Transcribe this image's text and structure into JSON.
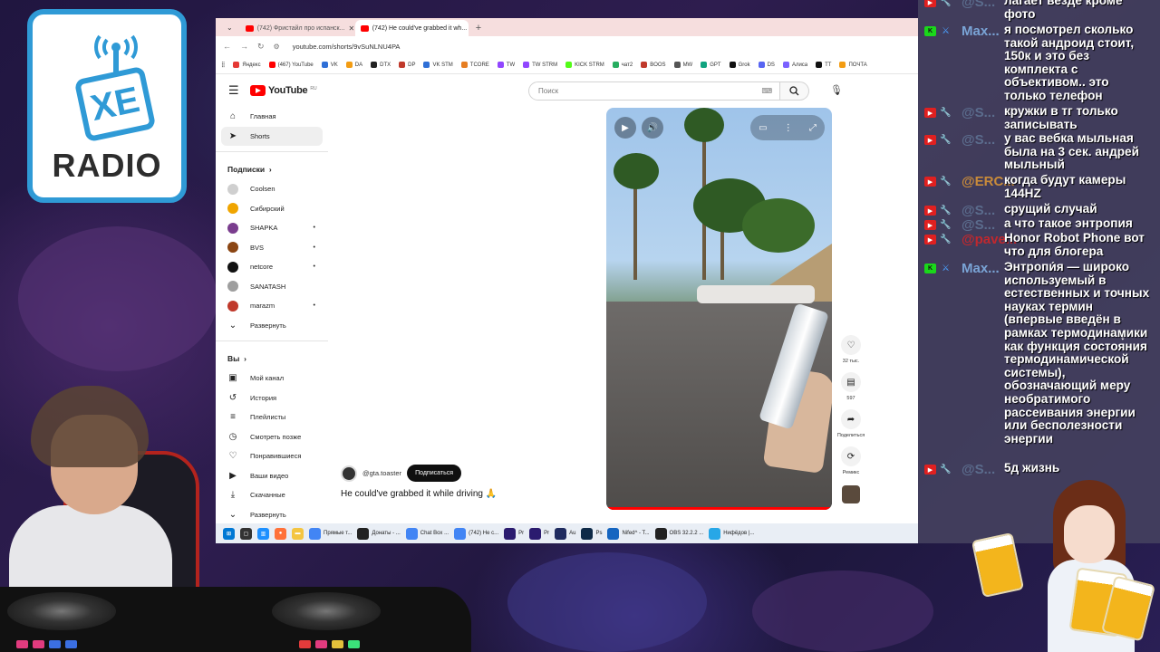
{
  "overlay": {
    "logo_text": "RADIO",
    "logo_mark": "XE"
  },
  "browser": {
    "tabs": [
      {
        "label": "(742) Фристайл про испанск...",
        "active": false
      },
      {
        "label": "(742) He could've grabbed it wh...",
        "active": true
      }
    ],
    "url": "youtube.com/shorts/9vSuNLNU4PA",
    "bookmarks": [
      {
        "label": "Яндекс",
        "color": "#e53935"
      },
      {
        "label": "(467) YouTube",
        "color": "#ff0000"
      },
      {
        "label": "VK",
        "color": "#2f6fd6"
      },
      {
        "label": "DA",
        "color": "#f39c12"
      },
      {
        "label": "DTX",
        "color": "#222222"
      },
      {
        "label": "DP",
        "color": "#c0392b"
      },
      {
        "label": "VK STM",
        "color": "#2f6fd6"
      },
      {
        "label": "TCORE",
        "color": "#e67e22"
      },
      {
        "label": "TW",
        "color": "#9146ff"
      },
      {
        "label": "TW STRM",
        "color": "#9146ff"
      },
      {
        "label": "KICK STRM",
        "color": "#53fc18"
      },
      {
        "label": "чат2",
        "color": "#27ae60"
      },
      {
        "label": "BOOS",
        "color": "#c0392b"
      },
      {
        "label": "MW",
        "color": "#555555"
      },
      {
        "label": "GPT",
        "color": "#10a37f"
      },
      {
        "label": "Grok",
        "color": "#111111"
      },
      {
        "label": "DS",
        "color": "#5865f2"
      },
      {
        "label": "Алиса",
        "color": "#7b61ff"
      },
      {
        "label": "TT",
        "color": "#111111"
      },
      {
        "label": "ПОЧТА",
        "color": "#f39c12"
      }
    ]
  },
  "youtube": {
    "logo_text": "YouTube",
    "logo_region": "RU",
    "search_placeholder": "Поиск",
    "nav": [
      {
        "label": "Главная",
        "icon": "home-icon",
        "glyph": "⌂",
        "active": false
      },
      {
        "label": "Shorts",
        "icon": "shorts-icon",
        "glyph": "➤",
        "active": true
      }
    ],
    "subscriptions_header": "Подписки",
    "subscriptions": [
      {
        "label": "Coolsen",
        "color": "#cfcfcf",
        "live": false
      },
      {
        "label": "Сибирский",
        "color": "#f0a500",
        "live": false
      },
      {
        "label": "SHAPKA",
        "color": "#7a3d8e",
        "live": true
      },
      {
        "label": "BVS",
        "color": "#8b4513",
        "live": true
      },
      {
        "label": "netcore",
        "color": "#111111",
        "live": true
      },
      {
        "label": "SANATASH",
        "color": "#9e9e9e",
        "live": false
      },
      {
        "label": "marazm",
        "color": "#c0392b",
        "live": true
      }
    ],
    "expand_label": "Развернуть",
    "you_header": "Вы",
    "you_items": [
      {
        "label": "Мой канал",
        "icon": "my-channel-icon",
        "glyph": "▣"
      },
      {
        "label": "История",
        "icon": "history-icon",
        "glyph": "↺"
      },
      {
        "label": "Плейлисты",
        "icon": "playlists-icon",
        "glyph": "≡"
      },
      {
        "label": "Смотреть позже",
        "icon": "watch-later-icon",
        "glyph": "◷"
      },
      {
        "label": "Понравившиеся",
        "icon": "liked-icon",
        "glyph": "♡"
      },
      {
        "label": "Ваши видео",
        "icon": "your-videos-icon",
        "glyph": "▶"
      },
      {
        "label": "Скачанные",
        "icon": "downloads-icon",
        "glyph": "⤓"
      },
      {
        "label": "Развернуть",
        "icon": "expand-icon",
        "glyph": "⌄"
      }
    ],
    "short": {
      "channel": "@gta.toaster",
      "subscribe_label": "Подписаться",
      "title": "He could've grabbed it while driving 🙏",
      "likes": "32 тыс.",
      "comments": "597",
      "share_label": "Поделиться",
      "remix_label": "Ремикс"
    }
  },
  "taskbar": [
    {
      "label": "Прямые т...",
      "color": "#4285f4"
    },
    {
      "label": "Донаты - ...",
      "color": "#222222"
    },
    {
      "label": "Chat Box ...",
      "color": "#4285f4"
    },
    {
      "label": "(742) Не с...",
      "color": "#4285f4"
    },
    {
      "label": "Pr",
      "color": "#2b1b6f"
    },
    {
      "label": "Pr",
      "color": "#2b1b6f"
    },
    {
      "label": "Au",
      "color": "#1f2b5f"
    },
    {
      "label": "Ps",
      "color": "#0e2a47"
    },
    {
      "label": "Nifed^ - T...",
      "color": "#1565c0"
    },
    {
      "label": "OBS 32.2.2 ...",
      "color": "#222222"
    },
    {
      "label": "Нифёдов |...",
      "color": "#27a7e7"
    }
  ],
  "chat": {
    "messages": [
      {
        "platform": "yt",
        "user": "@S...",
        "user_style": "",
        "text": "лагает везде кроме фото"
      },
      {
        "platform": "kick",
        "user": "Max...",
        "user_style": "kick-user",
        "text": "я посмотрел сколько такой андроид стоит, 150к и это без комплекта с объективом.. это только телефон"
      },
      {
        "platform": "yt",
        "user": "@S...",
        "user_style": "",
        "text": "кружки в тг только записывать"
      },
      {
        "platform": "yt",
        "user": "@S...",
        "user_style": "",
        "text": "у вас вебка мыльная была на 3 сек. андрей мыльный"
      },
      {
        "platform": "yt",
        "user": "@ERC...",
        "user_style": "orange",
        "text": "когда будут камеры 144HZ"
      },
      {
        "platform": "yt",
        "user": "@S...",
        "user_style": "",
        "text": "срущий случай"
      },
      {
        "platform": "yt",
        "user": "@S...",
        "user_style": "",
        "text": "а что такое энтропия"
      },
      {
        "platform": "yt",
        "user": "@pave...",
        "user_style": "red",
        "text": "Honor Robot Phone вот что для блогера"
      },
      {
        "platform": "kick",
        "user": "Max...",
        "user_style": "kick-user",
        "text": "Энтропи́я — широко используемый в естественных и точных науках термин (впервые введён в рамках термодинамики как функция состояния термодинамической системы), обозначающий меру необратимого рассеивания энергии или бесполезности энергии"
      },
      {
        "platform": "yt",
        "user": "@S...",
        "user_style": "",
        "text": "5д жизнь"
      }
    ]
  }
}
